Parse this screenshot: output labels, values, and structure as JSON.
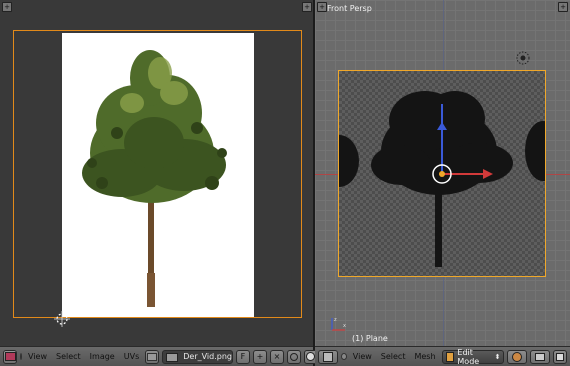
{
  "viewport": {
    "view_name": "Front Persp",
    "object_label": "(1) Plane"
  },
  "uv_header": {
    "menus": [
      "View",
      "Select",
      "Image",
      "UVs"
    ],
    "image_name": "Der_Vid.png",
    "fake_user_label": "F"
  },
  "view3d_header": {
    "menus": [
      "View",
      "Select",
      "Mesh"
    ],
    "mode": "Edit Mode"
  },
  "icons": {
    "plus": "+",
    "close": "×",
    "dropdown": "⬍"
  },
  "colors": {
    "selection_orange": "#e28a1a",
    "x_axis": "#d23a3a",
    "y_axis": "#5aba3a",
    "z_axis": "#3a5ad8"
  }
}
